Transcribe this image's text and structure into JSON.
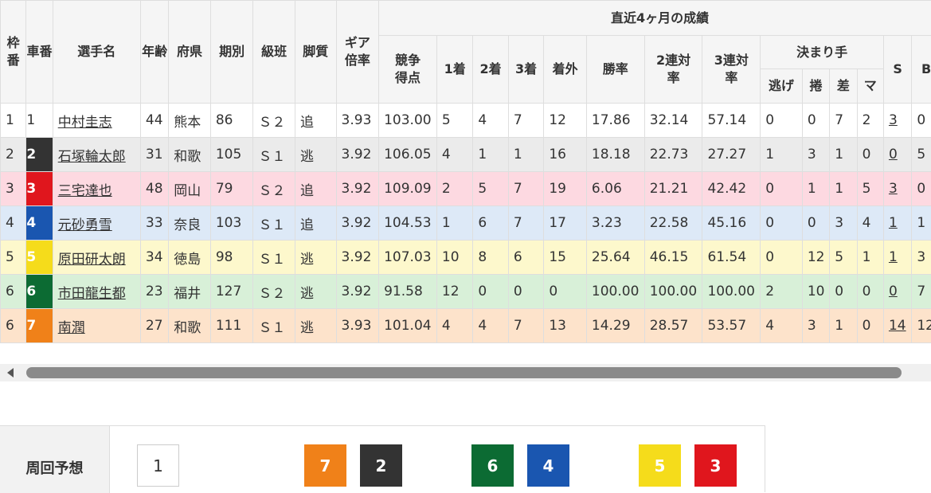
{
  "headers": {
    "waku": "枠番",
    "sha": "車番",
    "name": "選手名",
    "age": "年齢",
    "pref": "府県",
    "term": "期別",
    "rank": "級班",
    "style": "脚質",
    "gear": "ギア倍率",
    "recent": "直近4ヶ月の成績",
    "score": "競争得点",
    "first": "1着",
    "second": "2着",
    "third": "3着",
    "out": "着外",
    "win_rate": "勝率",
    "rentai2": "2連対率",
    "rentai3": "3連対率",
    "kimarite": "決まり手",
    "nige": "逃げ",
    "makuri": "捲",
    "sashi": "差",
    "mark": "マ",
    "s": "S",
    "b": "B"
  },
  "colors": {
    "car1": "#ffffff",
    "car2": "#333333",
    "car3": "#e0161d",
    "car4": "#1a56b0",
    "car5": "#f5dc1b",
    "car6": "#0c6b33",
    "car7": "#f08119"
  },
  "rows": [
    {
      "waku": "1",
      "sha": "1",
      "name": "中村圭志",
      "age": "44",
      "pref": "熊本",
      "term": "86",
      "rank": "Ｓ２",
      "style": "追",
      "gear": "3.93",
      "score": "103.00",
      "first": "5",
      "second": "4",
      "third": "7",
      "out": "12",
      "win": "17.86",
      "r2": "32.14",
      "r3": "57.14",
      "nige": "0",
      "makuri": "0",
      "sashi": "7",
      "mark": "2",
      "s": "3",
      "b": "0"
    },
    {
      "waku": "2",
      "sha": "2",
      "name": "石塚輪太郎",
      "age": "31",
      "pref": "和歌",
      "term": "105",
      "rank": "Ｓ１",
      "style": "逃",
      "gear": "3.92",
      "score": "106.05",
      "first": "4",
      "second": "1",
      "third": "1",
      "out": "16",
      "win": "18.18",
      "r2": "22.73",
      "r3": "27.27",
      "nige": "1",
      "makuri": "3",
      "sashi": "1",
      "mark": "0",
      "s": "0",
      "b": "5"
    },
    {
      "waku": "3",
      "sha": "3",
      "name": "三宅達也",
      "age": "48",
      "pref": "岡山",
      "term": "79",
      "rank": "Ｓ２",
      "style": "追",
      "gear": "3.92",
      "score": "109.09",
      "first": "2",
      "second": "5",
      "third": "7",
      "out": "19",
      "win": "6.06",
      "r2": "21.21",
      "r3": "42.42",
      "nige": "0",
      "makuri": "1",
      "sashi": "1",
      "mark": "5",
      "s": "3",
      "b": "0"
    },
    {
      "waku": "4",
      "sha": "4",
      "name": "元砂勇雪",
      "age": "33",
      "pref": "奈良",
      "term": "103",
      "rank": "Ｓ１",
      "style": "追",
      "gear": "3.92",
      "score": "104.53",
      "first": "1",
      "second": "6",
      "third": "7",
      "out": "17",
      "win": "3.23",
      "r2": "22.58",
      "r3": "45.16",
      "nige": "0",
      "makuri": "0",
      "sashi": "3",
      "mark": "4",
      "s": "1",
      "b": "1"
    },
    {
      "waku": "5",
      "sha": "5",
      "name": "原田研太朗",
      "age": "34",
      "pref": "徳島",
      "term": "98",
      "rank": "Ｓ１",
      "style": "逃",
      "gear": "3.92",
      "score": "107.03",
      "first": "10",
      "second": "8",
      "third": "6",
      "out": "15",
      "win": "25.64",
      "r2": "46.15",
      "r3": "61.54",
      "nige": "0",
      "makuri": "12",
      "sashi": "5",
      "mark": "1",
      "s": "1",
      "b": "3"
    },
    {
      "waku": "6",
      "sha": "6",
      "name": "市田龍生都",
      "age": "23",
      "pref": "福井",
      "term": "127",
      "rank": "Ｓ２",
      "style": "逃",
      "gear": "3.92",
      "score": "91.58",
      "first": "12",
      "second": "0",
      "third": "0",
      "out": "0",
      "win": "100.00",
      "r2": "100.00",
      "r3": "100.00",
      "nige": "2",
      "makuri": "10",
      "sashi": "0",
      "mark": "0",
      "s": "0",
      "b": "7"
    },
    {
      "waku": "6",
      "sha": "7",
      "name": "南潤",
      "age": "27",
      "pref": "和歌",
      "term": "111",
      "rank": "Ｓ１",
      "style": "逃",
      "gear": "3.93",
      "score": "101.04",
      "first": "4",
      "second": "4",
      "third": "7",
      "out": "13",
      "win": "14.29",
      "r2": "28.57",
      "r3": "53.57",
      "nige": "4",
      "makuri": "3",
      "sashi": "1",
      "mark": "0",
      "s": "14",
      "b": "12"
    }
  ],
  "lap": {
    "label": "周回予想",
    "cars": [
      "1",
      "7",
      "2",
      "6",
      "4",
      "5",
      "3"
    ]
  }
}
